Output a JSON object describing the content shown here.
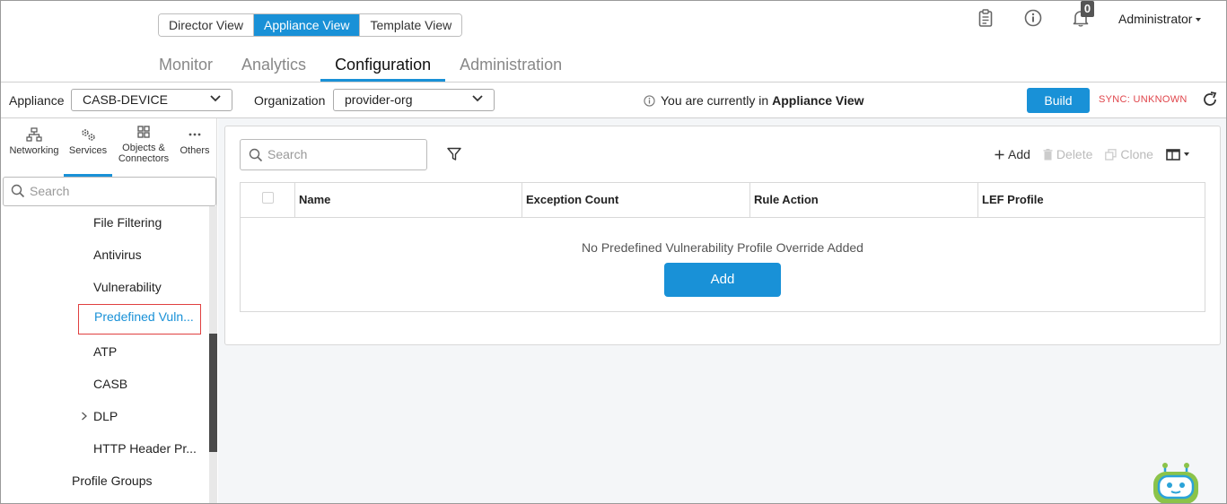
{
  "header": {
    "view_tabs": [
      "Director View",
      "Appliance View",
      "Template View"
    ],
    "active_view": "Appliance View",
    "notification_count": "0",
    "user": "Administrator",
    "nav_tabs": [
      "Monitor",
      "Analytics",
      "Configuration",
      "Administration"
    ],
    "active_nav": "Configuration"
  },
  "toolbar": {
    "appliance_label": "Appliance",
    "appliance_value": "CASB-DEVICE",
    "org_label": "Organization",
    "org_value": "provider-org",
    "info_text": "You are currently in",
    "info_bold": "Appliance View",
    "build_label": "Build",
    "sync_status": "SYNC: UNKNOWN"
  },
  "sidebar": {
    "categories": [
      {
        "label": "Networking",
        "icon": "networking-icon"
      },
      {
        "label": "Services",
        "icon": "services-icon"
      },
      {
        "label": "Objects & Connectors",
        "icon": "objects-icon"
      },
      {
        "label": "Others",
        "icon": "others-icon"
      }
    ],
    "active_category": "Services",
    "search_placeholder": "Search",
    "items": [
      {
        "label": "File Filtering"
      },
      {
        "label": "Antivirus"
      },
      {
        "label": "Vulnerability"
      },
      {
        "label": "Predefined Vuln..."
      },
      {
        "label": "ATP"
      },
      {
        "label": "CASB"
      },
      {
        "label": "DLP"
      },
      {
        "label": "HTTP Header Pr..."
      },
      {
        "label": "Profile Groups"
      }
    ],
    "selected_item": "Predefined Vuln..."
  },
  "main": {
    "search_placeholder": "Search",
    "actions": {
      "add": "Add",
      "delete": "Delete",
      "clone": "Clone"
    },
    "columns": [
      "Name",
      "Exception Count",
      "Rule Action",
      "LEF Profile"
    ],
    "empty_message": "No Predefined Vulnerability Profile Override Added",
    "add_button": "Add"
  },
  "colors": {
    "accent": "#1991d7",
    "sync_warning": "#e0454b",
    "selected_border": "#e04040"
  }
}
